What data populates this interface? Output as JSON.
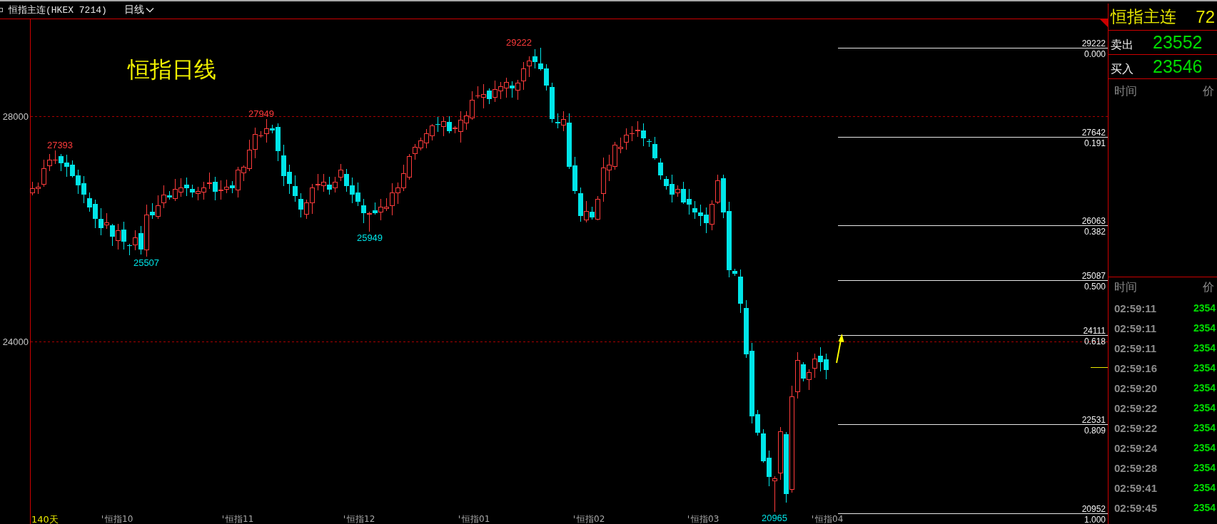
{
  "toolbar": {
    "title": "恒指主连(HKEX 7214)",
    "period": "日线"
  },
  "chart": {
    "title": "恒指日线",
    "y_ticks": [
      "28000",
      "24000"
    ],
    "extreme_labels": [
      {
        "text": "27393",
        "kind": "high"
      },
      {
        "text": "25507",
        "kind": "low"
      },
      {
        "text": "27949",
        "kind": "high"
      },
      {
        "text": "25949",
        "kind": "low"
      },
      {
        "text": "29222",
        "kind": "high"
      },
      {
        "text": "20965",
        "kind": "low"
      }
    ],
    "fibonacci_levels": [
      {
        "price": "29222",
        "ratio": "0.000"
      },
      {
        "price": "27642",
        "ratio": "0.191"
      },
      {
        "price": "26063",
        "ratio": "0.382"
      },
      {
        "price": "25087",
        "ratio": "0.500"
      },
      {
        "price": "24111",
        "ratio": "0.618"
      },
      {
        "price": "22531",
        "ratio": "0.809"
      },
      {
        "price": "20952",
        "ratio": "1.000"
      }
    ],
    "x_axis": {
      "range": "140天",
      "months": [
        "恒指10",
        "恒指11",
        "恒指12",
        "恒指01",
        "恒指02",
        "恒指03",
        "恒指04"
      ]
    }
  },
  "quote_panel": {
    "name": "恒指主连",
    "code": "72",
    "quotes": [
      {
        "label": "卖出",
        "price": "23552"
      },
      {
        "label": "买入",
        "price": "23546"
      }
    ],
    "upper_table": {
      "columns": [
        "时间",
        "价"
      ]
    },
    "lower_table": {
      "columns": [
        "时间",
        "价"
      ],
      "rows": [
        {
          "time": "02:59:11",
          "price": "2354"
        },
        {
          "time": "02:59:11",
          "price": "2354"
        },
        {
          "time": "02:59:11",
          "price": "2354"
        },
        {
          "time": "02:59:16",
          "price": "2354"
        },
        {
          "time": "02:59:20",
          "price": "2354"
        },
        {
          "time": "02:59:22",
          "price": "2354"
        },
        {
          "time": "02:59:22",
          "price": "2354"
        },
        {
          "time": "02:59:24",
          "price": "2354"
        },
        {
          "time": "02:59:28",
          "price": "2354"
        },
        {
          "time": "02:59:41",
          "price": "2354"
        },
        {
          "time": "02:59:45",
          "price": "2354"
        }
      ]
    }
  }
}
